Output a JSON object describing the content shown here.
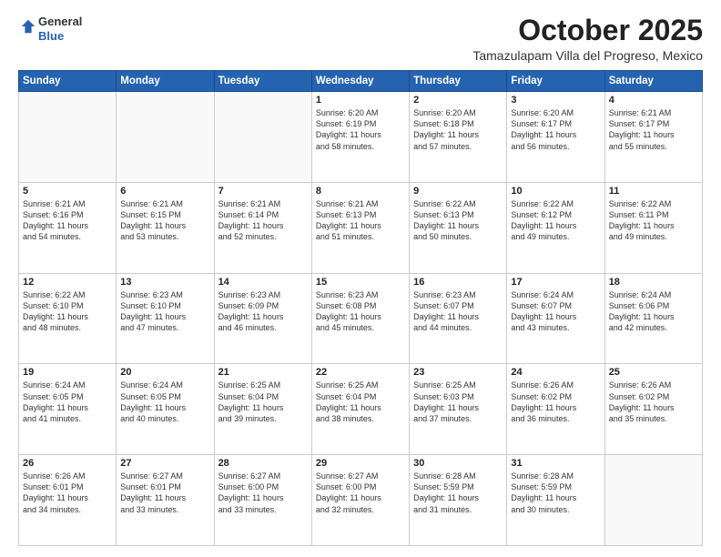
{
  "header": {
    "logo_general": "General",
    "logo_blue": "Blue",
    "month_title": "October 2025",
    "subtitle": "Tamazulapam Villa del Progreso, Mexico"
  },
  "days_of_week": [
    "Sunday",
    "Monday",
    "Tuesday",
    "Wednesday",
    "Thursday",
    "Friday",
    "Saturday"
  ],
  "weeks": [
    [
      {
        "day": "",
        "content": ""
      },
      {
        "day": "",
        "content": ""
      },
      {
        "day": "",
        "content": ""
      },
      {
        "day": "1",
        "content": "Sunrise: 6:20 AM\nSunset: 6:19 PM\nDaylight: 11 hours\nand 58 minutes."
      },
      {
        "day": "2",
        "content": "Sunrise: 6:20 AM\nSunset: 6:18 PM\nDaylight: 11 hours\nand 57 minutes."
      },
      {
        "day": "3",
        "content": "Sunrise: 6:20 AM\nSunset: 6:17 PM\nDaylight: 11 hours\nand 56 minutes."
      },
      {
        "day": "4",
        "content": "Sunrise: 6:21 AM\nSunset: 6:17 PM\nDaylight: 11 hours\nand 55 minutes."
      }
    ],
    [
      {
        "day": "5",
        "content": "Sunrise: 6:21 AM\nSunset: 6:16 PM\nDaylight: 11 hours\nand 54 minutes."
      },
      {
        "day": "6",
        "content": "Sunrise: 6:21 AM\nSunset: 6:15 PM\nDaylight: 11 hours\nand 53 minutes."
      },
      {
        "day": "7",
        "content": "Sunrise: 6:21 AM\nSunset: 6:14 PM\nDaylight: 11 hours\nand 52 minutes."
      },
      {
        "day": "8",
        "content": "Sunrise: 6:21 AM\nSunset: 6:13 PM\nDaylight: 11 hours\nand 51 minutes."
      },
      {
        "day": "9",
        "content": "Sunrise: 6:22 AM\nSunset: 6:13 PM\nDaylight: 11 hours\nand 50 minutes."
      },
      {
        "day": "10",
        "content": "Sunrise: 6:22 AM\nSunset: 6:12 PM\nDaylight: 11 hours\nand 49 minutes."
      },
      {
        "day": "11",
        "content": "Sunrise: 6:22 AM\nSunset: 6:11 PM\nDaylight: 11 hours\nand 49 minutes."
      }
    ],
    [
      {
        "day": "12",
        "content": "Sunrise: 6:22 AM\nSunset: 6:10 PM\nDaylight: 11 hours\nand 48 minutes."
      },
      {
        "day": "13",
        "content": "Sunrise: 6:23 AM\nSunset: 6:10 PM\nDaylight: 11 hours\nand 47 minutes."
      },
      {
        "day": "14",
        "content": "Sunrise: 6:23 AM\nSunset: 6:09 PM\nDaylight: 11 hours\nand 46 minutes."
      },
      {
        "day": "15",
        "content": "Sunrise: 6:23 AM\nSunset: 6:08 PM\nDaylight: 11 hours\nand 45 minutes."
      },
      {
        "day": "16",
        "content": "Sunrise: 6:23 AM\nSunset: 6:07 PM\nDaylight: 11 hours\nand 44 minutes."
      },
      {
        "day": "17",
        "content": "Sunrise: 6:24 AM\nSunset: 6:07 PM\nDaylight: 11 hours\nand 43 minutes."
      },
      {
        "day": "18",
        "content": "Sunrise: 6:24 AM\nSunset: 6:06 PM\nDaylight: 11 hours\nand 42 minutes."
      }
    ],
    [
      {
        "day": "19",
        "content": "Sunrise: 6:24 AM\nSunset: 6:05 PM\nDaylight: 11 hours\nand 41 minutes."
      },
      {
        "day": "20",
        "content": "Sunrise: 6:24 AM\nSunset: 6:05 PM\nDaylight: 11 hours\nand 40 minutes."
      },
      {
        "day": "21",
        "content": "Sunrise: 6:25 AM\nSunset: 6:04 PM\nDaylight: 11 hours\nand 39 minutes."
      },
      {
        "day": "22",
        "content": "Sunrise: 6:25 AM\nSunset: 6:04 PM\nDaylight: 11 hours\nand 38 minutes."
      },
      {
        "day": "23",
        "content": "Sunrise: 6:25 AM\nSunset: 6:03 PM\nDaylight: 11 hours\nand 37 minutes."
      },
      {
        "day": "24",
        "content": "Sunrise: 6:26 AM\nSunset: 6:02 PM\nDaylight: 11 hours\nand 36 minutes."
      },
      {
        "day": "25",
        "content": "Sunrise: 6:26 AM\nSunset: 6:02 PM\nDaylight: 11 hours\nand 35 minutes."
      }
    ],
    [
      {
        "day": "26",
        "content": "Sunrise: 6:26 AM\nSunset: 6:01 PM\nDaylight: 11 hours\nand 34 minutes."
      },
      {
        "day": "27",
        "content": "Sunrise: 6:27 AM\nSunset: 6:01 PM\nDaylight: 11 hours\nand 33 minutes."
      },
      {
        "day": "28",
        "content": "Sunrise: 6:27 AM\nSunset: 6:00 PM\nDaylight: 11 hours\nand 33 minutes."
      },
      {
        "day": "29",
        "content": "Sunrise: 6:27 AM\nSunset: 6:00 PM\nDaylight: 11 hours\nand 32 minutes."
      },
      {
        "day": "30",
        "content": "Sunrise: 6:28 AM\nSunset: 5:59 PM\nDaylight: 11 hours\nand 31 minutes."
      },
      {
        "day": "31",
        "content": "Sunrise: 6:28 AM\nSunset: 5:59 PM\nDaylight: 11 hours\nand 30 minutes."
      },
      {
        "day": "",
        "content": ""
      }
    ]
  ]
}
